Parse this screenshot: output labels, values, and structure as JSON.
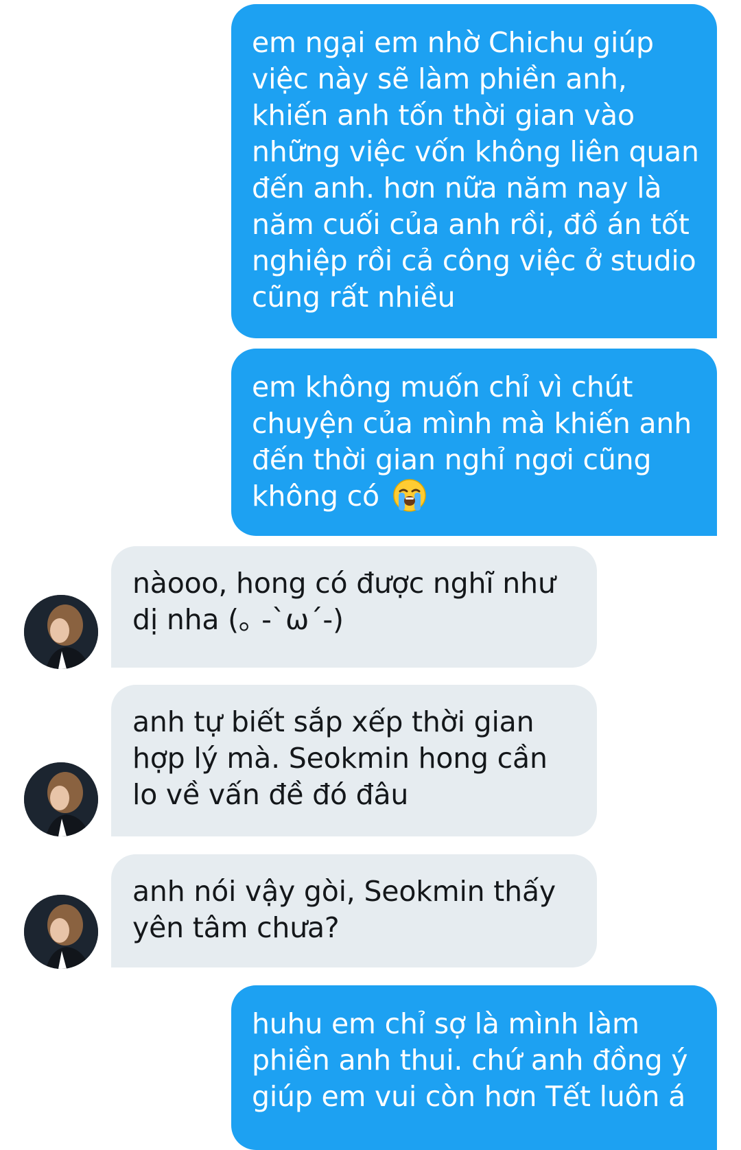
{
  "messages": [
    {
      "direction": "outgoing",
      "text": "em ngại em nhờ Chichu giúp việc này sẽ làm phiền anh, khiến anh tốn thời gian vào những việc vốn không liên quan đến anh. hơn nữa năm nay là năm cuối của anh rồi, đồ án tốt nghiệp rồi cả công việc ở studio cũng rất nhiều"
    },
    {
      "direction": "outgoing",
      "text": "em không muốn chỉ vì chút chuyện của mình mà khiến anh đến thời gian nghỉ ngơi cũng không có",
      "emoji": "loudly-crying-face"
    },
    {
      "direction": "incoming",
      "text": "nàooo, hong có được nghĩ như dị nha (｡ -`ω´-)"
    },
    {
      "direction": "incoming",
      "text": "anh tự biết sắp xếp thời gian hợp lý mà. Seokmin hong cần lo về vấn đề đó đâu"
    },
    {
      "direction": "incoming",
      "text": "anh nói vậy gòi, Seokmin thấy yên tâm chưa?"
    },
    {
      "direction": "outgoing",
      "text": "huhu em chỉ sợ là mình làm phiền anh thui. chứ anh đồng ý giúp em vui còn hơn Tết luôn á"
    }
  ],
  "colors": {
    "outgoing_bubble": "#1da1f2",
    "incoming_bubble": "#e6ecf0",
    "outgoing_text": "#ffffff",
    "incoming_text": "#14171a"
  }
}
